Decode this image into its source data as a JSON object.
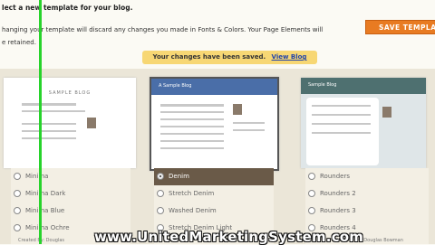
{
  "header": {
    "heading": "lect a new template for your blog.",
    "description_line1": "hanging your template will discard any changes you made in Fonts & Colors. Your Page Elements will",
    "description_line2": "e retained.",
    "save_button": "SAVE TEMPLA"
  },
  "notice": {
    "text": "Your changes have been saved.",
    "link": "View Blog"
  },
  "templates": [
    {
      "thumb_title": "SAMPLE BLOG",
      "options": [
        "Minima",
        "Minima Dark",
        "Minima Blue",
        "Minima Ochre"
      ],
      "selected": null
    },
    {
      "thumb_title": "A Sample Blog",
      "options": [
        "Denim",
        "Stretch Denim",
        "Washed Denim",
        "Stretch Denim Light"
      ],
      "selected": 0
    },
    {
      "thumb_title": "Sample Blog",
      "options": [
        "Rounders",
        "Rounders 2",
        "Rounders 3",
        "Rounders 4"
      ],
      "selected": null
    }
  ],
  "footer": {
    "left": "Created By: Douglas",
    "right": "By: Douglas Bowman"
  },
  "watermark": "www.UnitedMarketingSystem.com",
  "colors": {
    "save_button": "#e87b22",
    "notice_bg": "#f7d774",
    "selected_option": "#6a5a48",
    "accent_line": "#27d32b"
  }
}
